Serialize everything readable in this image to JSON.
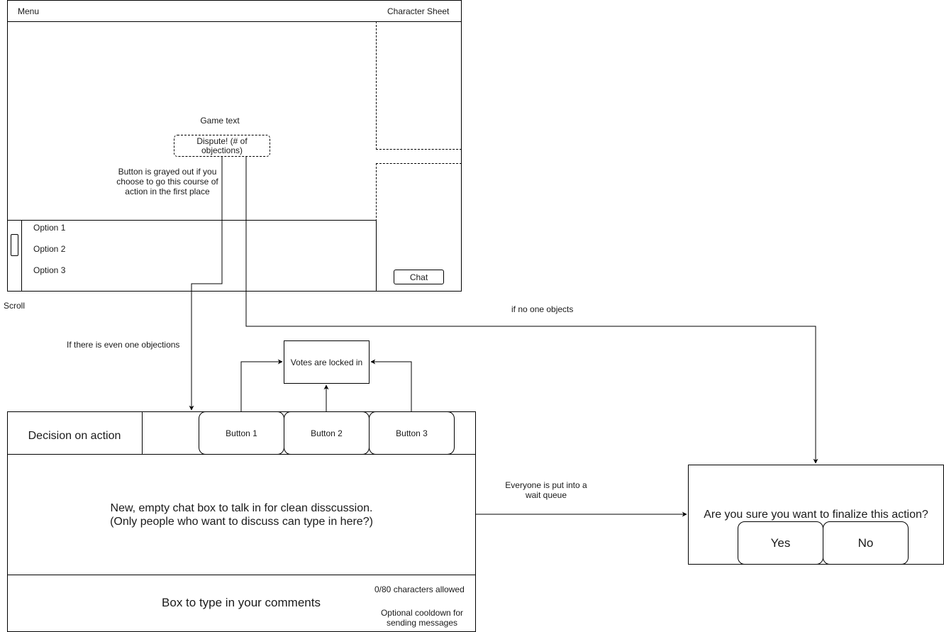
{
  "game_screen": {
    "header": {
      "menu_label": "Menu",
      "character_sheet_label": "Character Sheet"
    },
    "game_text": "Game text",
    "dispute_button_label": "Dispute! (# of objections)",
    "dispute_note": "Button is grayed out if you choose to go this course of action in the first place",
    "options": [
      "Option 1",
      "Option 2",
      "Option 3"
    ],
    "scroll_label": "Scroll",
    "chat_button_label": "Chat"
  },
  "flow_labels": {
    "objection": "If there is even one objections",
    "no_objection": "if no one objects",
    "wait_queue": "Everyone is put into a wait queue"
  },
  "votes_box": {
    "label": "Votes are locked in"
  },
  "decision_panel": {
    "title": "Decision on action",
    "buttons": [
      "Button 1",
      "Button 2",
      "Button 3"
    ],
    "chat_area_text_line1": "New, empty chat box to talk in for clean disscussion.",
    "chat_area_text_line2": "(Only people who want to discuss can type in here?)",
    "comment_box_placeholder": "Box to type in your comments",
    "char_counter": "0/80 characters allowed",
    "cooldown_note": "Optional cooldown for sending messages"
  },
  "confirm_dialog": {
    "question": "Are you sure you want to finalize this action?",
    "yes_label": "Yes",
    "no_label": "No"
  }
}
